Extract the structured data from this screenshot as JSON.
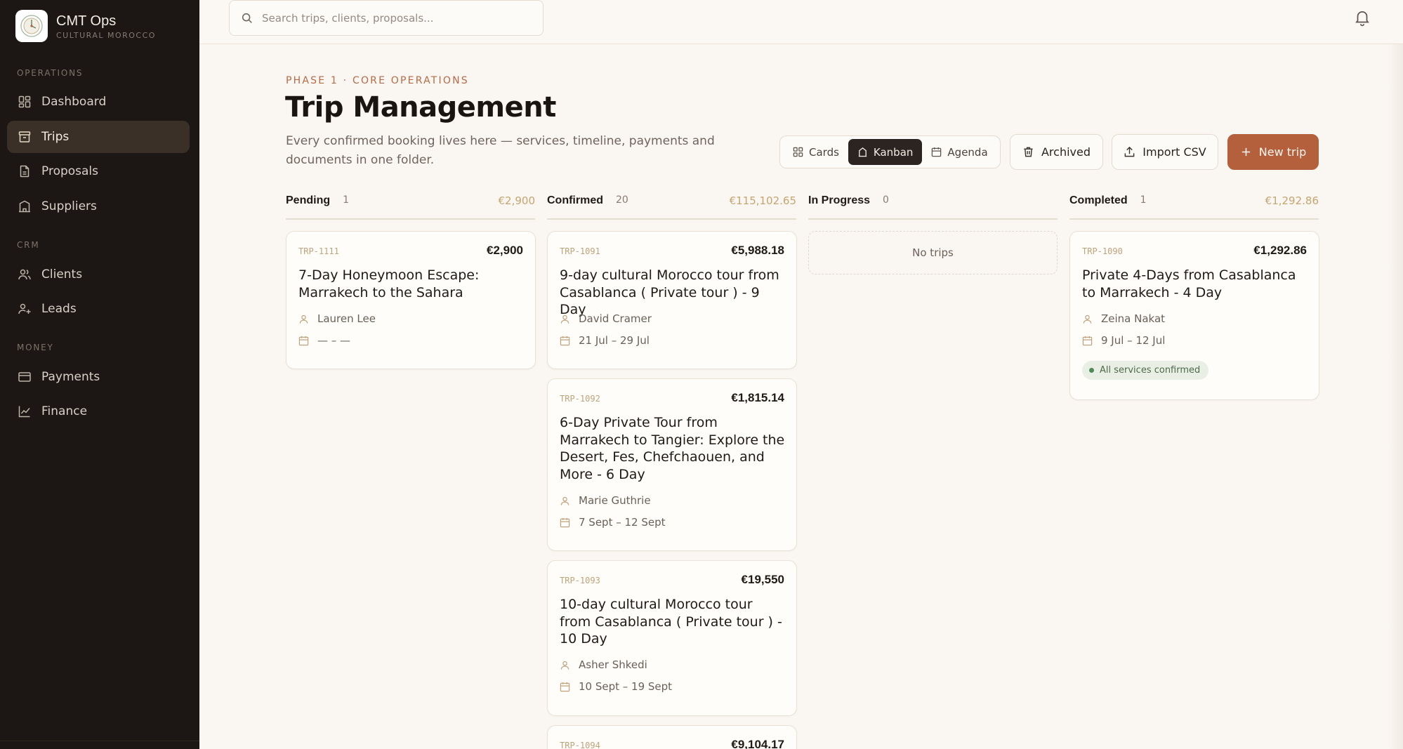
{
  "brand": {
    "name": "CMT Ops",
    "subtitle": "CULTURAL MOROCCO"
  },
  "sidebar": {
    "sections": [
      {
        "label": "OPERATIONS"
      },
      {
        "label": "CRM"
      },
      {
        "label": "MONEY"
      }
    ],
    "items": [
      {
        "label": "Dashboard",
        "icon": "dashboard-icon"
      },
      {
        "label": "Trips",
        "icon": "archive-icon",
        "active": true
      },
      {
        "label": "Proposals",
        "icon": "document-icon"
      },
      {
        "label": "Suppliers",
        "icon": "building-icon"
      },
      {
        "label": "Clients",
        "icon": "users-icon"
      },
      {
        "label": "Leads",
        "icon": "user-plus-icon"
      },
      {
        "label": "Payments",
        "icon": "credit-card-icon"
      },
      {
        "label": "Finance",
        "icon": "line-chart-icon"
      }
    ]
  },
  "search": {
    "placeholder": "Search trips, clients, proposals..."
  },
  "header": {
    "eyebrow": "PHASE 1 · CORE OPERATIONS",
    "title": "Trip Management",
    "subtitle": "Every confirmed booking lives here — services, timeline, payments and documents in one folder."
  },
  "view_toggle": {
    "options": [
      {
        "label": "Cards",
        "icon": "grid-icon"
      },
      {
        "label": "Kanban",
        "icon": "kanban-icon",
        "active": true
      },
      {
        "label": "Agenda",
        "icon": "calendar-icon"
      }
    ]
  },
  "actions": {
    "archived": "Archived",
    "import": "Import CSV",
    "new_trip": "New trip"
  },
  "columns": [
    {
      "name": "Pending",
      "count": "1",
      "total": "€2,900",
      "cards": [
        {
          "id": "TRP-1111",
          "price": "€2,900",
          "title": "7-Day Honeymoon Escape: Marrakech to the Sahara",
          "client": "Lauren Lee",
          "dates": "— – —"
        }
      ]
    },
    {
      "name": "Confirmed",
      "count": "20",
      "total": "€115,102.65",
      "cards": [
        {
          "id": "TRP-1091",
          "price": "€5,988.18",
          "title": "9-day cultural Morocco tour from Casablanca ( Private tour ) - 9 Day",
          "client": "David Cramer",
          "dates": "21 Jul – 29 Jul"
        },
        {
          "id": "TRP-1092",
          "price": "€1,815.14",
          "title": "6-Day Private Tour from Marrakech to Tangier: Explore the Desert, Fes, Chefchaouen, and More - 6 Day",
          "client": "Marie Guthrie",
          "dates": "7 Sept – 12 Sept"
        },
        {
          "id": "TRP-1093",
          "price": "€19,550",
          "title": "10-day cultural Morocco tour from Casablanca ( Private tour ) - 10 Day",
          "client": "Asher Shkedi",
          "dates": "10 Sept – 19 Sept"
        },
        {
          "id": "TRP-1094",
          "price": "€9,104.17"
        }
      ]
    },
    {
      "name": "In Progress",
      "count": "0",
      "total": "",
      "empty_label": "No trips"
    },
    {
      "name": "Completed",
      "count": "1",
      "total": "€1,292.86",
      "cards": [
        {
          "id": "TRP-1090",
          "price": "€1,292.86",
          "title": "Private 4-Days from Casablanca to Marrakech - 4 Day",
          "client": "Zeina Nakat",
          "dates": "9 Jul – 12 Jul",
          "badge": "All services confirmed"
        }
      ]
    }
  ],
  "colors": {
    "accent": "#b5603d",
    "sidebar": "#1c1714",
    "background": "#faf6f1",
    "total": "#c5a571",
    "badge_green": "#4e8a57"
  }
}
